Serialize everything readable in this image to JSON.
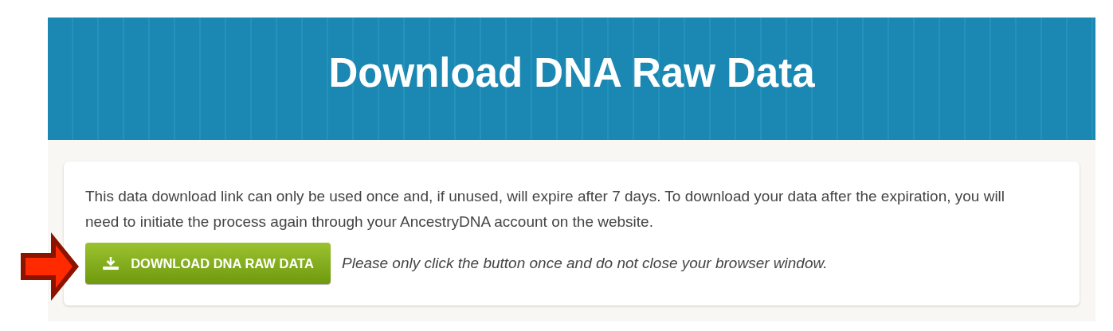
{
  "banner": {
    "title": "Download DNA Raw Data"
  },
  "card": {
    "message": "This data download link can only be used once and, if unused, will expire after 7 days. To download your data after the expiration, you will need to initiate the process again through your AncestryDNA account on the website.",
    "button": {
      "label": "DOWNLOAD DNA RAW DATA"
    },
    "note": "Please only click the button once and do not close your browser window."
  }
}
